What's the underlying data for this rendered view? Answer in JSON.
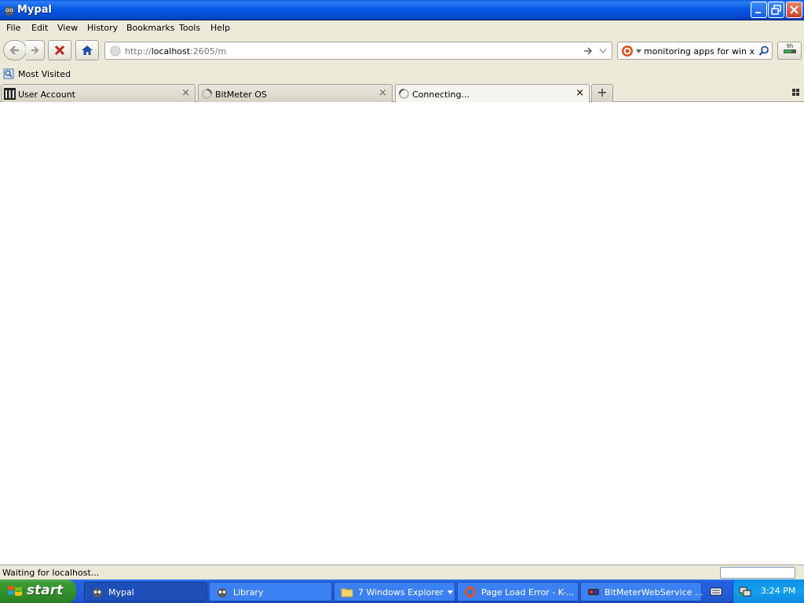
{
  "window": {
    "title": "Mypal"
  },
  "menu": {
    "items": [
      "File",
      "Edit",
      "View",
      "History",
      "Bookmarks",
      "Tools",
      "Help"
    ]
  },
  "navigation": {
    "url_prefix": "http://",
    "url_host": "localhost",
    "url_rest": ":2605/m",
    "search_text": "ork monitoring apps for win x"
  },
  "bookmarks": {
    "most_visited": "Most Visited"
  },
  "tabs": [
    {
      "label": "User Account",
      "icon": "bitmeter-bars-icon"
    },
    {
      "label": "BitMeter OS",
      "icon": "loading-spinner-icon"
    },
    {
      "label": "Connecting...",
      "icon": "loading-spinner-icon",
      "active": true
    }
  ],
  "status": {
    "text": "Waiting for localhost..."
  },
  "taskbar": {
    "start": "start",
    "tasks": [
      {
        "label": "Mypal",
        "icon": "mypal-icon",
        "active": true
      },
      {
        "label": "Library",
        "icon": "mypal-icon"
      },
      {
        "label": "7 Windows Explorer",
        "icon": "folder-icon"
      },
      {
        "label": "Page Load Error - K-...",
        "icon": "browser-icon"
      },
      {
        "label": "BitMeterWebService ...",
        "icon": "service-icon"
      }
    ],
    "clock": "3:24 PM"
  },
  "colors": {
    "titlebar": "#0758e6",
    "chrome": "#ece9d8",
    "taskbar": "#245edb",
    "start": "#308f2a"
  }
}
